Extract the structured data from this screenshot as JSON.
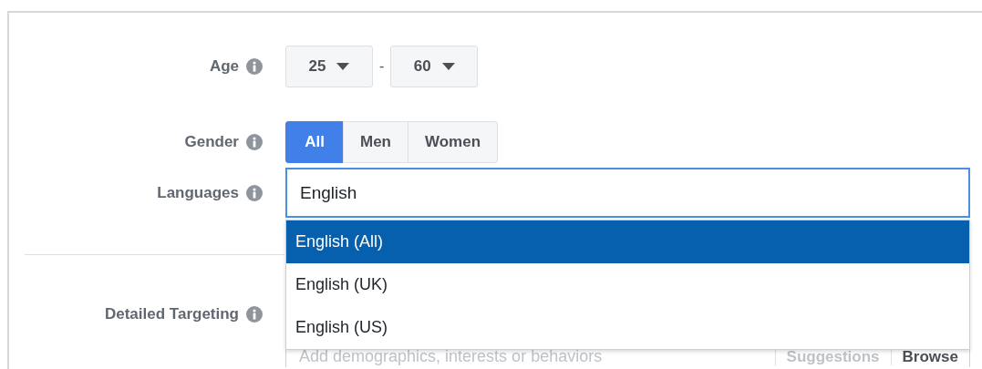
{
  "fields": [
    {
      "kind": "age",
      "label": "Age",
      "min": "25",
      "separator": "-",
      "max": "60"
    },
    {
      "kind": "gender",
      "label": "Gender",
      "options": [
        {
          "label": "All",
          "selected": true
        },
        {
          "label": "Men",
          "selected": false
        },
        {
          "label": "Women",
          "selected": false
        }
      ]
    },
    {
      "kind": "languages",
      "label": "Languages",
      "value": "English",
      "suggestions": [
        {
          "label": "English (All)",
          "selected": true
        },
        {
          "label": "English (UK)",
          "selected": false
        },
        {
          "label": "English (US)",
          "selected": false
        }
      ]
    },
    {
      "kind": "targeting",
      "label": "Detailed Targeting",
      "placeholder": "Add demographics, interests or behaviors",
      "links": [
        {
          "label": "Suggestions",
          "disabled": true
        },
        {
          "label": "Browse",
          "disabled": false
        }
      ]
    }
  ]
}
